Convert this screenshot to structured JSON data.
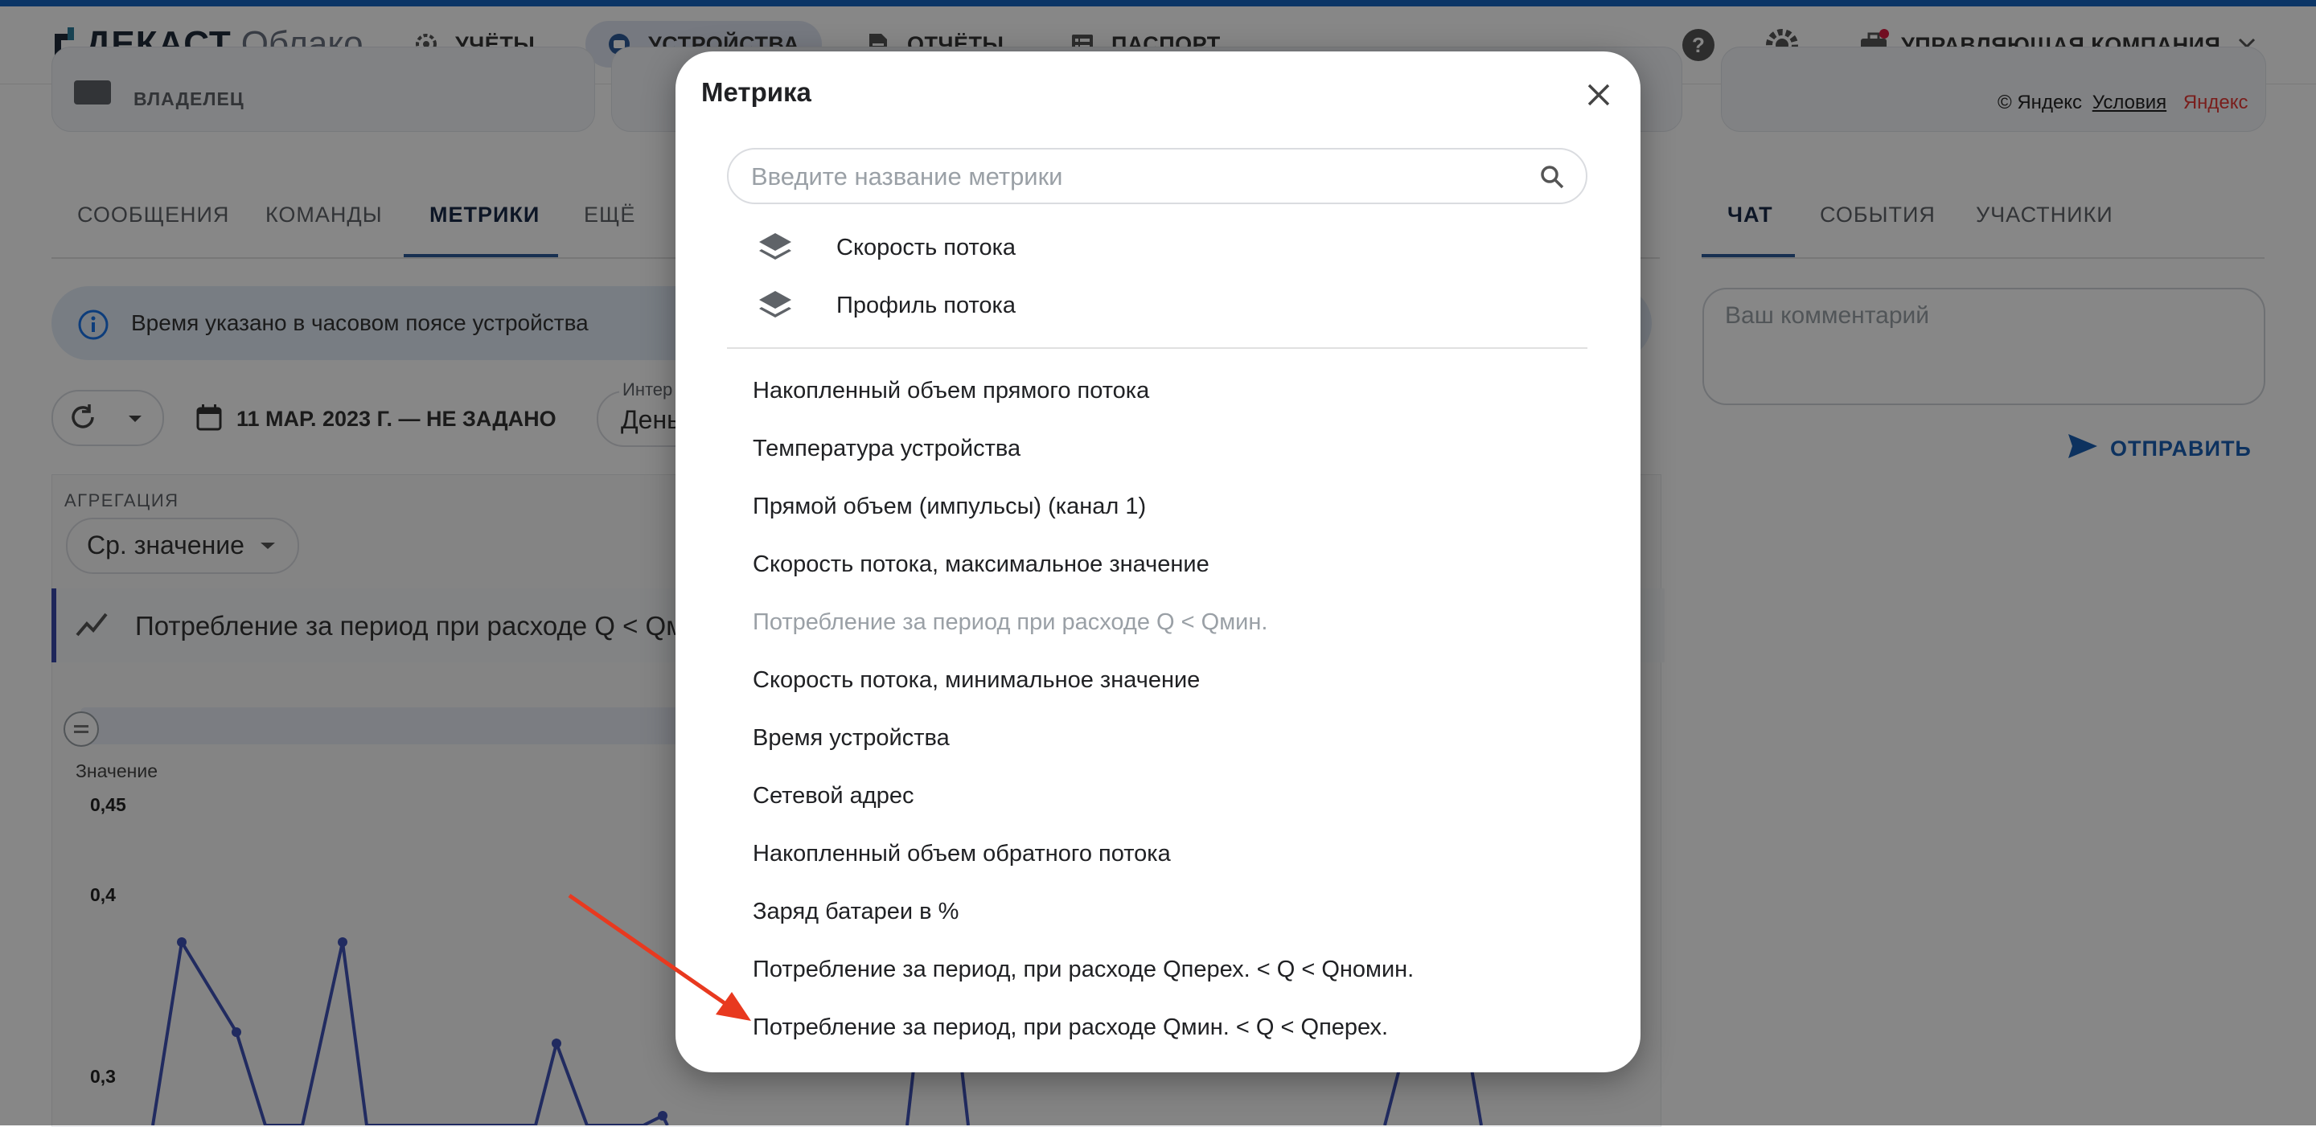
{
  "header": {
    "brand": "ДЕКАСТ",
    "brand_sub": "Облако",
    "nav": [
      {
        "label": "УЧЁТЫ",
        "icon": "gear-badge-icon"
      },
      {
        "label": "УСТРОЙСТВА",
        "icon": "device-icon",
        "active": true
      },
      {
        "label": "ОТЧЁТЫ",
        "icon": "document-icon"
      },
      {
        "label": "ПАСПОРТ",
        "icon": "passport-icon"
      }
    ],
    "help_icon": "help-icon",
    "settings_icon": "settings-icon",
    "company": "УПРАВЛЯЮЩАЯ КОМПАНИЯ",
    "accent_color": "#1565c0"
  },
  "page": {
    "owner_label": "ВЛАДЕЛЕЦ",
    "yandex_copyright": "© Яндекс",
    "yandex_terms": "Условия",
    "yandex_brand": "Яндекс",
    "tabs": [
      "СООБЩЕНИЯ",
      "КОМАНДЫ",
      "МЕТРИКИ",
      "ЕЩЁ"
    ],
    "active_tab": "МЕТРИКИ",
    "right_tabs": [
      "ЧАТ",
      "СОБЫТИЯ",
      "УЧАСТНИКИ"
    ],
    "info_text": "Время указано в часовом поясе устройства",
    "date_range": "11 МАР. 2023 Г. — НЕ ЗАДАНО",
    "interval_label": "Интер",
    "interval_value": "День",
    "aggregation_label": "АГРЕГАЦИЯ",
    "aggregation_value": "Ср. значение",
    "metric_row": "Потребление за период при расходе Q < Qмин",
    "chart_value_label": "Значение",
    "comment_placeholder": "Ваш комментарий",
    "send_label": "ОТПРАВИТЬ"
  },
  "chart_data": {
    "type": "line",
    "ylabel": "Значение",
    "yticks": [
      "0,45",
      "0,4",
      "0,3"
    ],
    "series_color": "#3f51b5"
  },
  "modal": {
    "title": "Метрика",
    "search_placeholder": "Введите название метрики",
    "layers": [
      {
        "label": "Скорость потока",
        "icon": "layers-icon"
      },
      {
        "label": "Профиль потока",
        "icon": "layers-icon"
      }
    ],
    "metrics": [
      {
        "label": "Накопленный объем прямого потока",
        "disabled": false
      },
      {
        "label": "Температура устройства",
        "disabled": false
      },
      {
        "label": "Прямой объем (импульсы) (канал 1)",
        "disabled": false
      },
      {
        "label": "Скорость потока, максимальное значение",
        "disabled": false
      },
      {
        "label": "Потребление за период при расходе Q < Qмин.",
        "disabled": true
      },
      {
        "label": "Скорость потока, минимальное значение",
        "disabled": false
      },
      {
        "label": "Время устройства",
        "disabled": false
      },
      {
        "label": "Сетевой адрес",
        "disabled": false
      },
      {
        "label": "Накопленный объем обратного потока",
        "disabled": false
      },
      {
        "label": "Заряд батареи в %",
        "disabled": false
      },
      {
        "label": "Потребление за период, при расходе Qперех. < Q < Qномин.",
        "disabled": false
      },
      {
        "label": "Потребление за период, при расходе Qмин. < Q < Qперех.",
        "disabled": false
      }
    ]
  },
  "annotation_arrow_color": "#e8391f"
}
